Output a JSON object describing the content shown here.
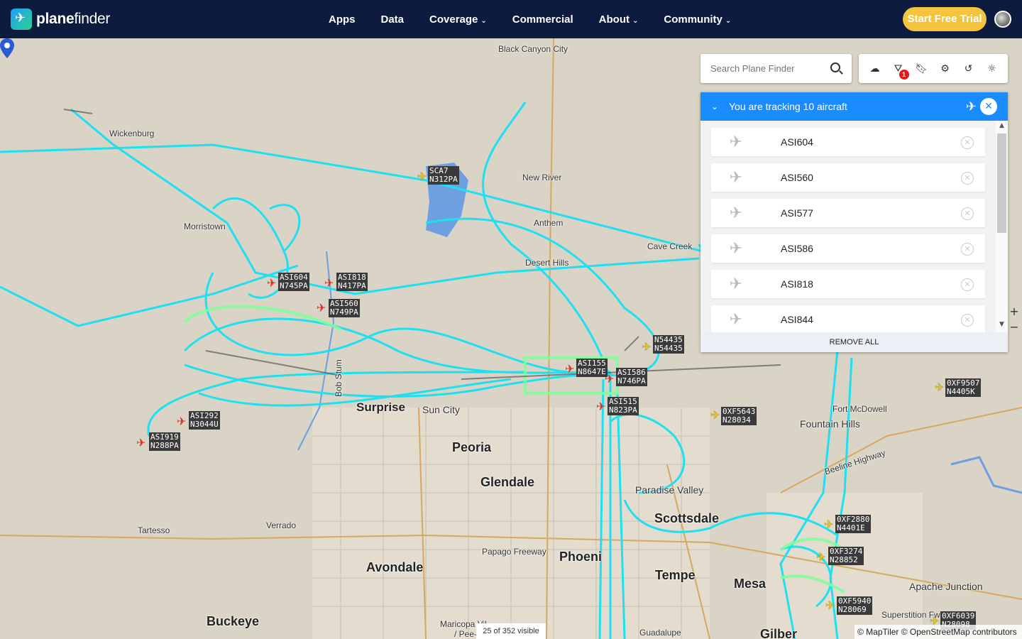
{
  "brand": {
    "name_bold": "plane",
    "name_light": "finder"
  },
  "nav": {
    "items": [
      {
        "label": "Apps",
        "dropdown": false
      },
      {
        "label": "Data",
        "dropdown": false
      },
      {
        "label": "Coverage",
        "dropdown": true
      },
      {
        "label": "Commercial",
        "dropdown": false
      },
      {
        "label": "About",
        "dropdown": true
      },
      {
        "label": "Community",
        "dropdown": true
      }
    ],
    "trial_label": "Start Free Trial"
  },
  "search": {
    "placeholder": "Search Plane Finder"
  },
  "toolbar": {
    "icons": [
      "cloud-upload-icon",
      "filter-icon",
      "bookmark-icon",
      "settings-icon",
      "history-icon",
      "weather-icon"
    ],
    "filter_badge": "1"
  },
  "tracking": {
    "title": "You are tracking 10 aircraft",
    "items": [
      "ASI604",
      "ASI560",
      "ASI577",
      "ASI586",
      "ASI818",
      "ASI844"
    ],
    "remove_all": "REMOVE ALL"
  },
  "map": {
    "places": {
      "black_canyon_city": "Black Canyon City",
      "wickenburg": "Wickenburg",
      "morristown": "Morristown",
      "new_river": "New River",
      "anthem": "Anthem",
      "cave_creek": "Cave Creek",
      "desert_hills": "Desert Hills",
      "surprise": "Surprise",
      "sun_city": "Sun City",
      "peoria": "Peoria",
      "glendale": "Glendale",
      "paradise_valley": "Paradise Valley",
      "scottsdale": "Scottsdale",
      "fort_mcdowell": "Fort McDowell",
      "fountain_hills": "Fountain Hills",
      "beeline_highway": "Beeline Highway",
      "tartesso": "Tartesso",
      "verrado": "Verrado",
      "avondale": "Avondale",
      "papago_freeway": "Papago Freeway",
      "phoenix": "Phoeni",
      "tempe": "Tempe",
      "mesa": "Mesa",
      "apache_junction": "Apache Junction",
      "buckeye": "Buckeye",
      "maricopa_village": "Maricopa Vil",
      "pee_posh": "/ Pee-p",
      "guadalupe": "Guadalupe",
      "superstition_fwy": "Superstition Fw",
      "gilbert": "Gilber",
      "bob_stump": "Bob Stum"
    },
    "flights": [
      {
        "callsign": "SCA7",
        "reg": "N312PA",
        "color": "yellow"
      },
      {
        "callsign": "ASI604",
        "reg": "N745PA",
        "color": "red"
      },
      {
        "callsign": "ASI818",
        "reg": "N417PA",
        "color": "red"
      },
      {
        "callsign": "ASI560",
        "reg": "N749PA",
        "color": "red"
      },
      {
        "callsign": "N54435",
        "reg": "N54435",
        "color": "yellow"
      },
      {
        "callsign": "ASI155",
        "reg": "N8647E",
        "color": "red"
      },
      {
        "callsign": "ASI586",
        "reg": "N746PA",
        "color": "red"
      },
      {
        "callsign": "ASI515",
        "reg": "N823PA",
        "color": "red"
      },
      {
        "callsign": "0XF9507",
        "reg": "N4405K",
        "color": "yellow"
      },
      {
        "callsign": "0XF5643",
        "reg": "N28034",
        "color": "yellow"
      },
      {
        "callsign": "ASI292",
        "reg": "N3044U",
        "color": "red"
      },
      {
        "callsign": "ASI919",
        "reg": "N288PA",
        "color": "red"
      },
      {
        "callsign": "0XF2880",
        "reg": "N4401E",
        "color": "yellow"
      },
      {
        "callsign": "0XF3274",
        "reg": "N28852",
        "color": "yellow"
      },
      {
        "callsign": "0XF5940",
        "reg": "N28069",
        "color": "yellow"
      },
      {
        "callsign": "0XF6039",
        "reg": "N28098",
        "color": "yellow"
      }
    ],
    "visible_count": "25 of 352 visible",
    "attribution": "© MapTiler © OpenStreetMap contributors",
    "track_color": "#1fe0f0",
    "track_highlight": "#7dff9a"
  }
}
